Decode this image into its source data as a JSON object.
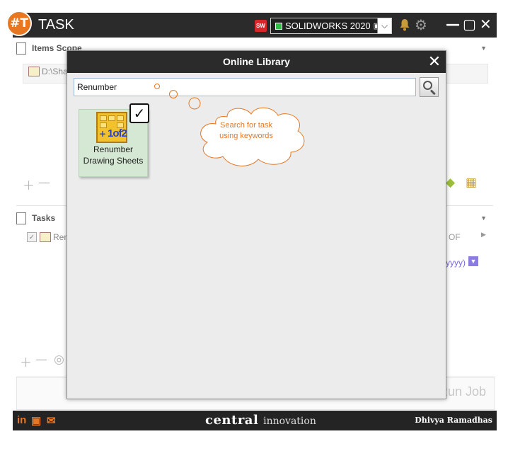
{
  "app": {
    "title": "TASK",
    "logo_text": "#T",
    "sw_badge": "SW",
    "version": "SOLIDWORKS 2020",
    "brand_main": "central",
    "brand_sub": "innovation",
    "user": "Dhivya Ramadhas",
    "accent_color": "#e87722"
  },
  "items_scope": {
    "title": "Items Scope",
    "item_label": "D:\\Sha"
  },
  "tasks_panel": {
    "title": "Tasks",
    "row_label": "Ren",
    "right_partial_1": "OF",
    "right_partial_2": "yyyy)",
    "run_job_label": "Run Job"
  },
  "window_controls": {
    "minimize": "—",
    "maximize": "▢",
    "close": "✕"
  },
  "modal": {
    "title": "Online Library",
    "close_label": "✕",
    "search_value": "Renumber",
    "tile": {
      "line1": "Renumber",
      "line2": "Drawing Sheets",
      "icon_text": "1of2"
    },
    "check_mark": "✓",
    "callout_line1": "Search for task",
    "callout_line2": "using keywords"
  },
  "social": {
    "linkedin": "in",
    "youtube": "▣",
    "email": "✉"
  },
  "icons": {
    "bell": "🔔",
    "gear": "⚙",
    "chevron": "⌵",
    "plus": "＋",
    "minus": "—"
  }
}
